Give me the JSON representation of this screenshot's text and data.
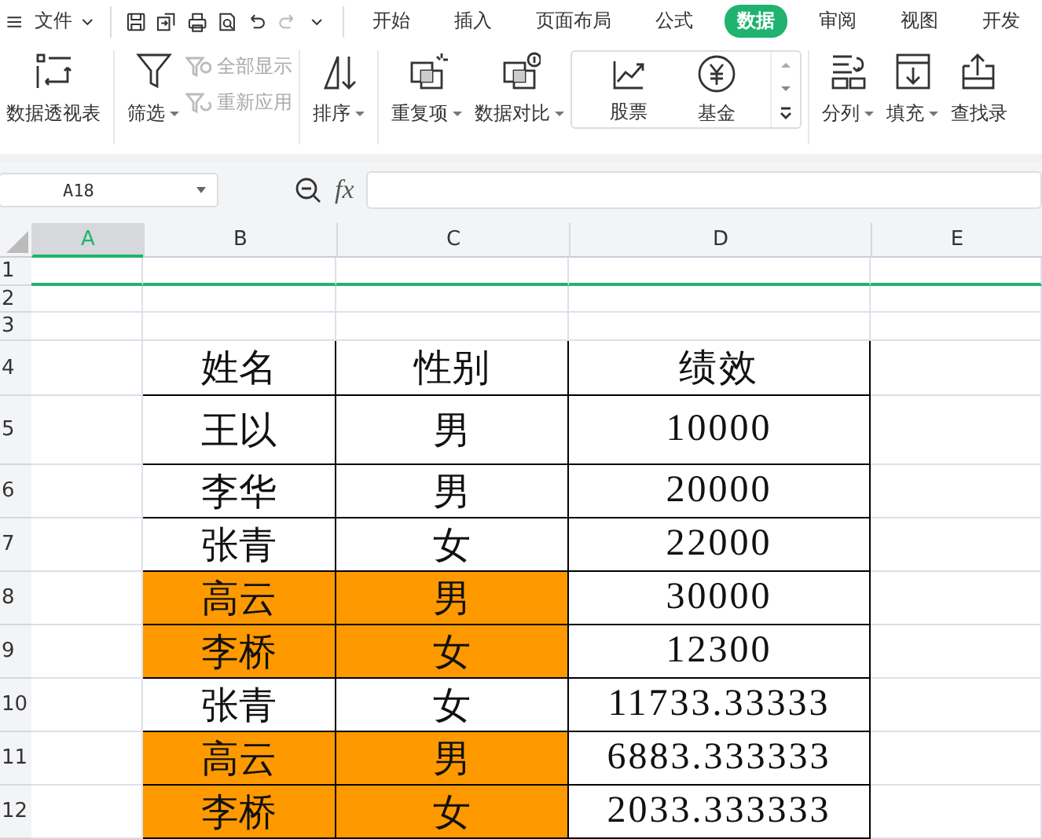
{
  "menu_bar": {
    "file_menu": "文件",
    "tabs": [
      {
        "label": "开始",
        "selected": false
      },
      {
        "label": "插入",
        "selected": false
      },
      {
        "label": "页面布局",
        "selected": false
      },
      {
        "label": "公式",
        "selected": false
      },
      {
        "label": "数据",
        "selected": true
      },
      {
        "label": "审阅",
        "selected": false
      },
      {
        "label": "视图",
        "selected": false
      },
      {
        "label": "开发",
        "selected": false
      }
    ]
  },
  "ribbon": {
    "items": [
      {
        "kind": "large",
        "label": "数据透视表",
        "dropdown": false
      },
      {
        "kind": "large",
        "label": "筛选",
        "dropdown": true
      },
      {
        "kind": "smallpair",
        "items": [
          {
            "label": "全部显示",
            "disabled": true
          },
          {
            "label": "重新应用",
            "disabled": true
          }
        ]
      },
      {
        "kind": "large",
        "label": "排序",
        "dropdown": true
      },
      {
        "kind": "large",
        "label": "重复项",
        "dropdown": true
      },
      {
        "kind": "large",
        "label": "数据对比",
        "dropdown": true
      },
      {
        "kind": "gallery",
        "items": [
          {
            "label": "股票"
          },
          {
            "label": "基金"
          }
        ]
      },
      {
        "kind": "large",
        "label": "分列",
        "dropdown": true
      },
      {
        "kind": "large",
        "label": "填充",
        "dropdown": true
      },
      {
        "kind": "large",
        "label": "查找录",
        "dropdown": false
      }
    ]
  },
  "formula_bar": {
    "name_box": "A18",
    "fx": "fx"
  },
  "sheet": {
    "columns": [
      {
        "label": "A",
        "selected": true
      },
      {
        "label": "B",
        "selected": false
      },
      {
        "label": "C",
        "selected": false
      },
      {
        "label": "D",
        "selected": false
      },
      {
        "label": "E",
        "selected": false
      }
    ],
    "rows": [
      {
        "number": "1"
      },
      {
        "number": "2"
      },
      {
        "number": "3"
      },
      {
        "number": "4",
        "cells": [
          "姓名",
          "性别",
          "绩效"
        ],
        "highlighted": false
      },
      {
        "number": "5",
        "cells": [
          "王以",
          "男",
          "10000"
        ],
        "highlighted": false
      },
      {
        "number": "6",
        "cells": [
          "李华",
          "男",
          "20000"
        ],
        "highlighted": false
      },
      {
        "number": "7",
        "cells": [
          "张青",
          "女",
          "22000"
        ],
        "highlighted": false
      },
      {
        "number": "8",
        "cells": [
          "高云",
          "男",
          "30000"
        ],
        "highlighted": true
      },
      {
        "number": "9",
        "cells": [
          "李桥",
          "女",
          "12300"
        ],
        "highlighted": true
      },
      {
        "number": "10",
        "cells": [
          "张青",
          "女",
          "11733.33333"
        ],
        "highlighted": false
      },
      {
        "number": "11",
        "cells": [
          "高云",
          "男",
          "6883.333333"
        ],
        "highlighted": true
      },
      {
        "number": "12",
        "cells": [
          "李桥",
          "女",
          "2033.333333"
        ],
        "highlighted": true
      }
    ]
  }
}
